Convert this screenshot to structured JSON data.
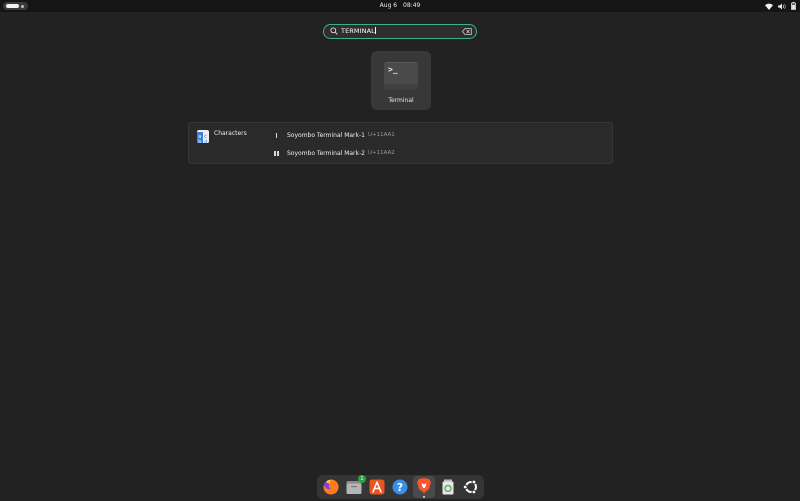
{
  "topbar": {
    "date": "Aug 6",
    "time": "08:49",
    "icons": [
      "activities-indicator",
      "wifi-icon",
      "volume-icon",
      "battery-icon"
    ]
  },
  "search": {
    "query": "TERMINAL",
    "icons": [
      "search-icon",
      "clear-icon"
    ]
  },
  "apps": [
    {
      "label": "Terminal",
      "icon": "terminal-icon",
      "glyph": ">_"
    }
  ],
  "provider": {
    "name": "Characters",
    "icon": "characters-app-icon",
    "results": [
      {
        "name": "Soyombo Terminal Mark-1",
        "code": "U+11AA1"
      },
      {
        "name": "Soyombo Terminal Mark-2",
        "code": "U+11AA2"
      }
    ]
  },
  "dock": {
    "items": [
      {
        "icon": "firefox-icon"
      },
      {
        "icon": "files-icon",
        "badge": "1"
      },
      {
        "icon": "app-center-icon"
      },
      {
        "icon": "help-icon"
      },
      {
        "icon": "brave-icon"
      },
      {
        "icon": "trash-icon"
      },
      {
        "icon": "ubuntu-logo-icon"
      }
    ]
  },
  "colors": {
    "accent": "#3fae8a",
    "background": "#222222",
    "topbar": "#151515"
  }
}
